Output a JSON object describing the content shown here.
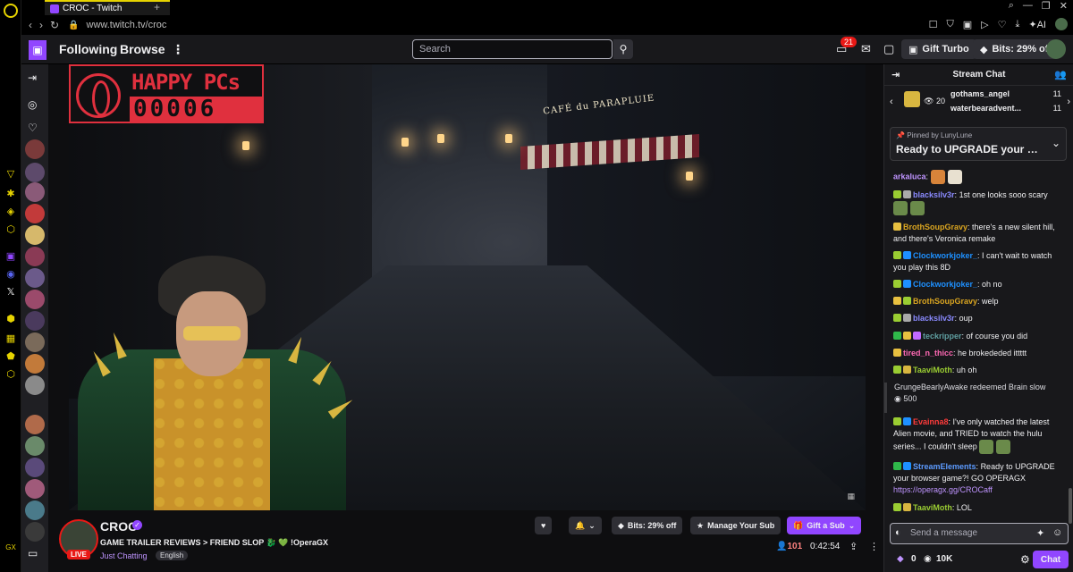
{
  "browser": {
    "tab_title": "CROC - Twitch",
    "url": "www.twitch.tv/croc",
    "ai_label": "AI"
  },
  "topnav": {
    "following": "Following",
    "browse": "Browse",
    "search_placeholder": "Search",
    "notifications_count": "21",
    "gift_turbo": "Gift Turbo",
    "bits_offer": "Bits: 29% off"
  },
  "overlay": {
    "happy_pcs_line1": "HAPPY PCs",
    "happy_pcs_counter": "00006",
    "cafe_sign": "CAFÉ du PARAPLUIE"
  },
  "channel": {
    "name": "CROC",
    "live": "LIVE",
    "title": "GAME TRAILER REVIEWS > FRIEND SLOP 🐉 💚 !OperaGX",
    "category": "Just Chatting",
    "tag": "English",
    "bits_button": "Bits: 29% off",
    "manage_sub": "Manage Your Sub",
    "gift_sub": "Gift a Sub",
    "viewers": "101",
    "uptime": "0:42:54"
  },
  "chat": {
    "header": "Stream Chat",
    "leaderboard": {
      "left_count": "20",
      "rows": [
        {
          "name": "gothams_angel",
          "count": "11"
        },
        {
          "name": "waterbearadvent...",
          "count": "11"
        }
      ]
    },
    "pinned": {
      "by_label": "Pinned by",
      "by_user": "LunyLune",
      "message": "Ready to UPGRADE your br..."
    },
    "messages": [
      {
        "user": "arkaluca",
        "color": "#bf94ff",
        "text": ""
      },
      {
        "user": "blacksilv3r",
        "color": "#8a8aff",
        "text": "1st one looks sooo scary"
      },
      {
        "user": "BrothSoupGravy",
        "color": "#daa520",
        "text": "there's a new silent hill, and there's Veronica remake"
      },
      {
        "user": "Clockworkjoker_",
        "color": "#1e90ff",
        "text": "I can't wait to watch you play this 8D"
      },
      {
        "user": "Clockworkjoker_",
        "color": "#1e90ff",
        "text": "oh no"
      },
      {
        "user": "BrothSoupGravy",
        "color": "#daa520",
        "text": "welp"
      },
      {
        "user": "blacksilv3r",
        "color": "#8a8aff",
        "text": "oup"
      },
      {
        "user": "teckripper",
        "color": "#5f9ea0",
        "text": "of course you did"
      },
      {
        "user": "tired_n_thicc",
        "color": "#ff69b4",
        "text": "he brokededed ittttt"
      },
      {
        "user": "TaaviMoth",
        "color": "#9acd32",
        "text": "uh oh"
      },
      {
        "user": "Evainna8",
        "color": "#ff3b3b",
        "text": "I've only watched the latest Alien movie, and TRIED to watch the hulu series... I couldn't sleep"
      },
      {
        "user": "StreamElements",
        "color": "#5c9bff",
        "text": "Ready to UPGRADE your browser game?! GO OPERAGX",
        "link": "https://operagx.gg/CROCaff"
      },
      {
        "user": "TaaviMoth",
        "color": "#9acd32",
        "text": "LOL"
      }
    ],
    "redeem": {
      "text": "GrungeBearlyAwake redeemed Brain slow",
      "points": "500"
    },
    "input_placeholder": "Send a message",
    "points_a": "0",
    "points_b": "10K",
    "chat_button": "Chat"
  }
}
